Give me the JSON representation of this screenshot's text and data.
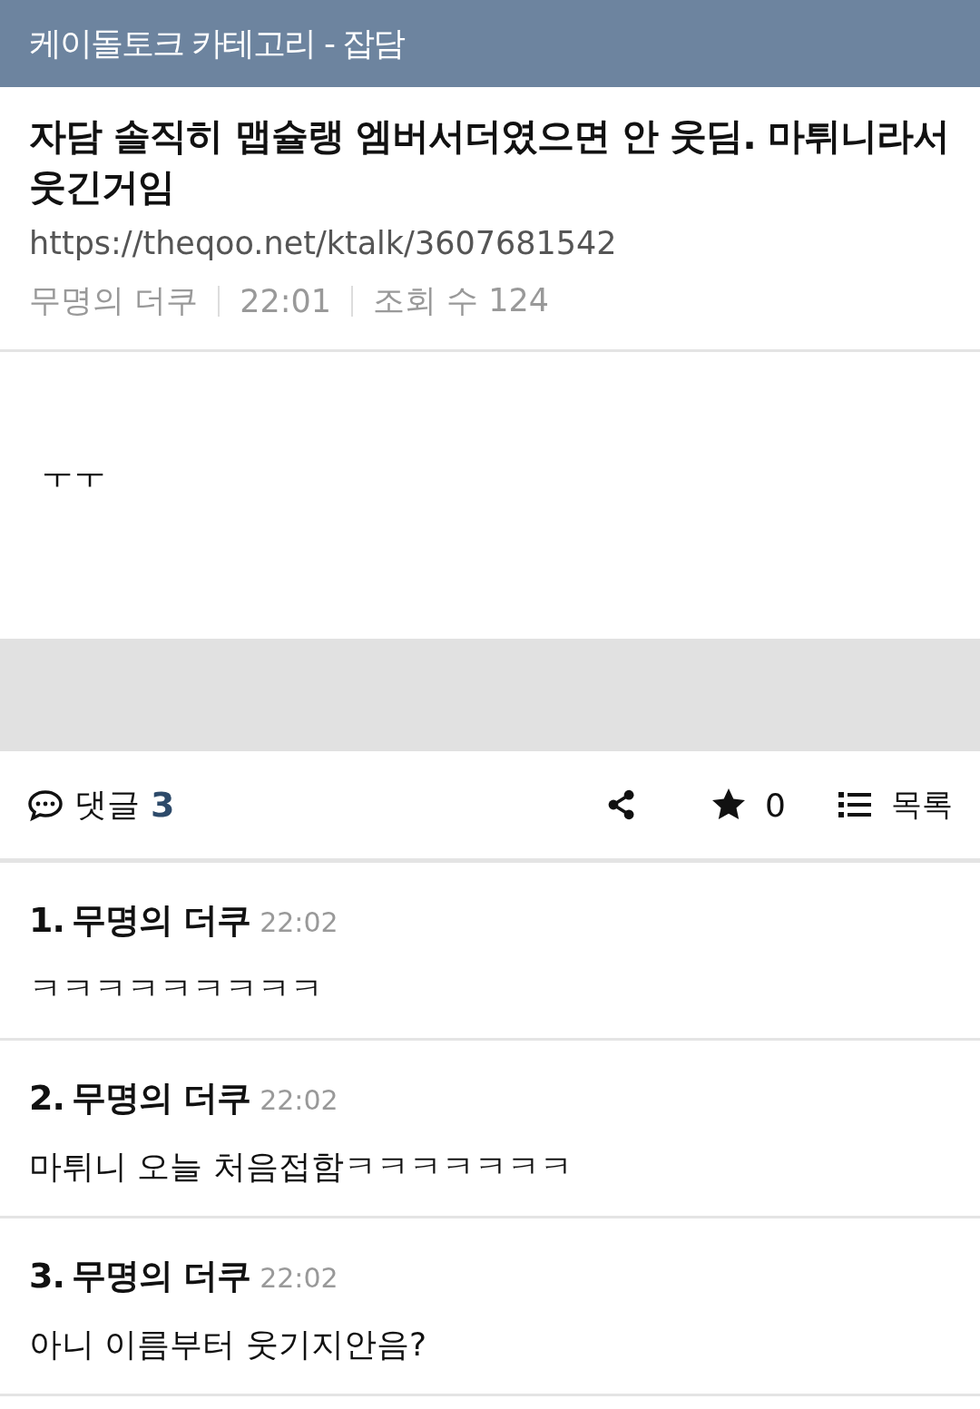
{
  "header": {
    "title": "케이돌토크 카테고리 - 잡담"
  },
  "post": {
    "title": "자담 솔직히 맵슐랭 엠버서더였으면 안 웃딤. 마튀니라서 웃긴거임",
    "url": "https://theqoo.net/ktalk/3607681542",
    "author": "무명의 더쿠",
    "time": "22:01",
    "views": "조회 수 124",
    "body": "ㅜㅜ"
  },
  "actions": {
    "comments_label": "댓글",
    "comments_count": "3",
    "favorites_count": "0",
    "list_label": "목록"
  },
  "comments": [
    {
      "number": "1.",
      "author": "무명의 더쿠",
      "time": "22:02",
      "text": "ㅋㅋㅋㅋㅋㅋㅋㅋㅋ"
    },
    {
      "number": "2.",
      "author": "무명의 더쿠",
      "time": "22:02",
      "text": "마튀니 오늘 처음접함ㅋㅋㅋㅋㅋㅋㅋ"
    },
    {
      "number": "3.",
      "author": "무명의 더쿠",
      "time": "22:02",
      "text": "아니 이름부터 웃기지안음?"
    }
  ]
}
